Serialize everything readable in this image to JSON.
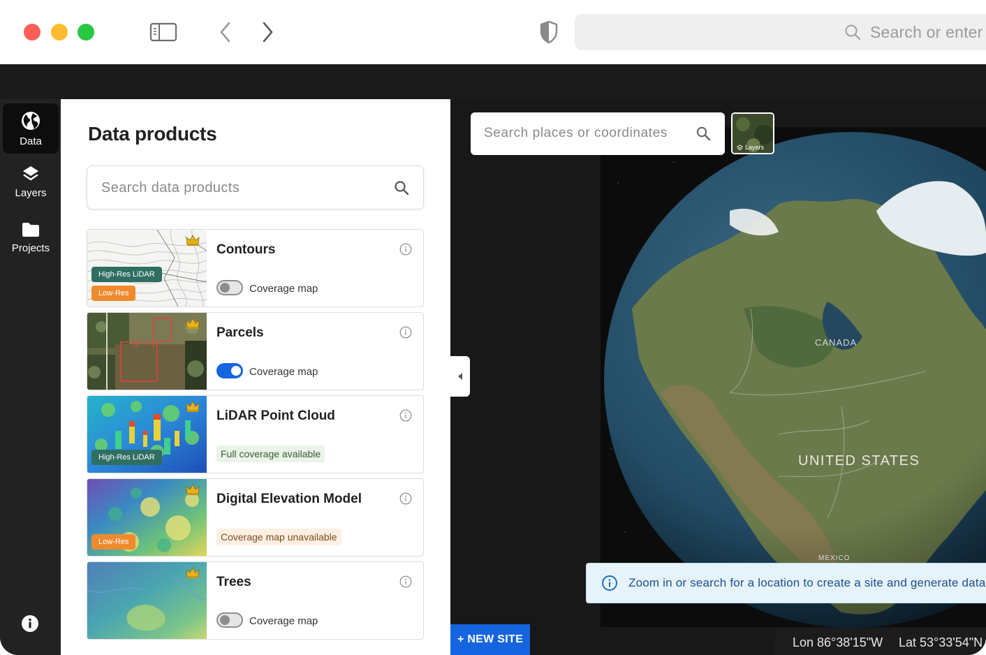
{
  "browser": {
    "url_placeholder": "Search or enter"
  },
  "rail": {
    "items": [
      {
        "label": "Data",
        "icon": "globe-icon"
      },
      {
        "label": "Layers",
        "icon": "layers-icon"
      },
      {
        "label": "Projects",
        "icon": "folder-icon"
      }
    ]
  },
  "panel": {
    "title": "Data products",
    "search_placeholder": "Search data products",
    "cards": [
      {
        "title": "Contours",
        "badges": [
          "High-Res LiDAR",
          "Low-Res"
        ],
        "toggle_label": "Coverage map",
        "toggle_on": false
      },
      {
        "title": "Parcels",
        "toggle_label": "Coverage map",
        "toggle_on": true
      },
      {
        "title": "LiDAR Point Cloud",
        "badges": [
          "High-Res LiDAR"
        ],
        "status": "Full coverage available"
      },
      {
        "title": "Digital Elevation Model",
        "badges": [
          "Low-Res"
        ],
        "status": "Coverage map unavailable"
      },
      {
        "title": "Trees",
        "toggle_label": "Coverage map",
        "toggle_on": false
      }
    ]
  },
  "map": {
    "search_placeholder": "Search places or coordinates",
    "layers_label": "Layers",
    "labels": {
      "canada": "CANADA",
      "usa": "UNITED STATES",
      "mexico": "MEXICO"
    },
    "info_banner": "Zoom in or search for a location to create a site and generate data",
    "new_site": "+ NEW SITE",
    "lon": "Lon 86°38'15\"W",
    "lat": "Lat 53°33'54\"N"
  },
  "colors": {
    "accent": "#1565e0",
    "lidar_badge": "#2f6e62",
    "lowres_badge": "#ef8b2f"
  }
}
